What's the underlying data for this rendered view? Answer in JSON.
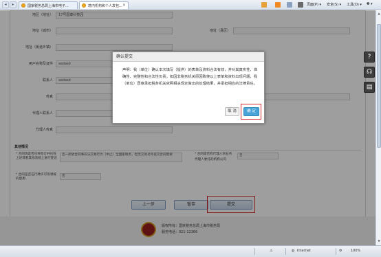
{
  "browser": {
    "tabs": [
      {
        "label": "国家税务总局上海市电子..."
      },
      {
        "label": "境内机构和个人发包..."
      }
    ],
    "toolbar": {
      "page": "页面(P) ▾",
      "safety": "安全(S) ▾",
      "tools": "工具(O) ▾",
      "help": "❷ ▾"
    }
  },
  "form": {
    "rows": [
      {
        "label": "地区（地址）",
        "value": "17号国泰科技园"
      },
      {
        "label": "地址（城市）",
        "value": ""
      },
      {
        "label": "地址（县区）",
        "value": ""
      },
      {
        "label": "地址（街道乡镇）",
        "value": ""
      },
      {
        "label": "用户名称及证件",
        "value": "asdasd"
      },
      {
        "label": "联系人",
        "value": "asdasd"
      },
      {
        "label": "传真",
        "value": ""
      },
      {
        "label": "电话",
        "value": ""
      },
      {
        "label": "代理人联系人",
        "value": ""
      },
      {
        "label": "代理人传真",
        "value": ""
      }
    ],
    "other_section": "其他情况",
    "conditions": [
      {
        "label": "* 合同等是否已经签订并已在上述或者其他法规上进行登记",
        "value": "否一所依合同事非法交易行为（中止）全国家税务，但无交易对外提交合同需要",
        "label2": "与合同提交的海外申报"
      },
      {
        "label": "* 合同是否有代理人的业务",
        "value": "否",
        "label2": "代理人委托的机构公司"
      },
      {
        "label": "* 合同是否在行政许可等领域的使用",
        "value": "否",
        "label2": ""
      }
    ],
    "buttons": {
      "prev": "上一步",
      "draft": "暂存",
      "submit": "提交"
    }
  },
  "footer": {
    "line1": "版权所有：国家税务总局上海市税务局",
    "line2": "服务电话：021-12366"
  },
  "dialog": {
    "title": "确认提交",
    "body": "声明：我（单位）确认本次填写（提供）的表单及资料合法有效，并对其真实性、准确性、完整性和合法性负责。如因非税务机关原因致使以上表单和资料出现问题，我（单位）愿意承担税务机关依照相关规定做出的处理结果，并承担相应的法律责任。",
    "cancel": "取 消",
    "ok": "确 定"
  },
  "side_icons": [
    "help-icon",
    "headset-icon",
    "save-icon"
  ],
  "status": {
    "zone": "Internet",
    "zoom": "100%"
  },
  "colors": {
    "highlight": "#d9272e",
    "ok_button": "#49a4d8",
    "mask": "rgba(0,0,0,0.38)"
  }
}
